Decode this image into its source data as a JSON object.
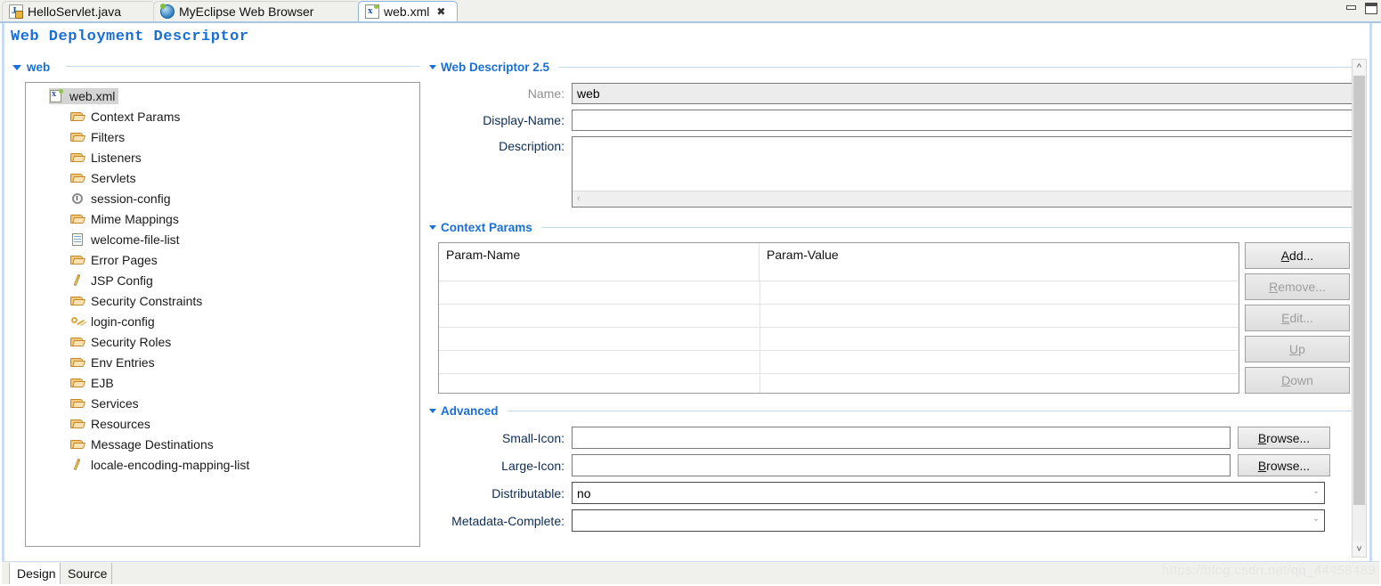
{
  "window": {
    "minimize_label": "minimize",
    "maximize_label": "maximize"
  },
  "editor_tabs": [
    {
      "label": "HelloServlet.java",
      "icon": "java-file-icon",
      "active": false,
      "closable": false
    },
    {
      "label": "MyEclipse Web Browser",
      "icon": "globe-icon",
      "active": false,
      "closable": false
    },
    {
      "label": "web.xml",
      "icon": "xml-file-icon",
      "active": true,
      "closable": true,
      "close_glyph": "✖"
    }
  ],
  "page_title": "Web Deployment Descriptor",
  "tree_section": {
    "header": "web",
    "nodes": [
      {
        "label": "web.xml",
        "icon": "xml-file-icon",
        "selected": true,
        "depth": 0
      },
      {
        "label": "Context Params",
        "icon": "folder-icon",
        "selected": false,
        "depth": 1
      },
      {
        "label": "Filters",
        "icon": "folder-icon",
        "selected": false,
        "depth": 1
      },
      {
        "label": "Listeners",
        "icon": "folder-icon",
        "selected": false,
        "depth": 1
      },
      {
        "label": "Servlets",
        "icon": "folder-icon",
        "selected": false,
        "depth": 1
      },
      {
        "label": "session-config",
        "icon": "clock-icon",
        "selected": false,
        "depth": 1
      },
      {
        "label": "Mime Mappings",
        "icon": "folder-icon",
        "selected": false,
        "depth": 1
      },
      {
        "label": "welcome-file-list",
        "icon": "document-icon",
        "selected": false,
        "depth": 1
      },
      {
        "label": "Error Pages",
        "icon": "folder-icon",
        "selected": false,
        "depth": 1
      },
      {
        "label": "JSP Config",
        "icon": "pencil-icon",
        "selected": false,
        "depth": 1
      },
      {
        "label": "Security Constraints",
        "icon": "folder-icon",
        "selected": false,
        "depth": 1
      },
      {
        "label": "login-config",
        "icon": "key-icon",
        "selected": false,
        "depth": 1
      },
      {
        "label": "Security Roles",
        "icon": "folder-icon",
        "selected": false,
        "depth": 1
      },
      {
        "label": "Env Entries",
        "icon": "folder-icon",
        "selected": false,
        "depth": 1
      },
      {
        "label": "EJB",
        "icon": "folder-icon",
        "selected": false,
        "depth": 1
      },
      {
        "label": "Services",
        "icon": "folder-icon",
        "selected": false,
        "depth": 1
      },
      {
        "label": "Resources",
        "icon": "folder-icon",
        "selected": false,
        "depth": 1
      },
      {
        "label": "Message Destinations",
        "icon": "folder-icon",
        "selected": false,
        "depth": 1
      },
      {
        "label": "locale-encoding-mapping-list",
        "icon": "pencil-icon",
        "selected": false,
        "depth": 1
      }
    ]
  },
  "descriptor_section": {
    "header": "Web Descriptor 2.5",
    "name_label": "Name:",
    "name_value": "web",
    "display_name_label": "Display-Name:",
    "display_name_value": "",
    "description_label": "Description:",
    "description_value": ""
  },
  "context_params_section": {
    "header": "Context Params",
    "columns": [
      "Param-Name",
      "Param-Value"
    ],
    "rows": [],
    "empty_row_count": 5,
    "buttons": [
      {
        "label": "Add...",
        "mnemonic": "A",
        "enabled": true
      },
      {
        "label": "Remove...",
        "mnemonic": "R",
        "enabled": false
      },
      {
        "label": "Edit...",
        "mnemonic": "E",
        "enabled": false
      },
      {
        "label": "Up",
        "mnemonic": "U",
        "enabled": false
      },
      {
        "label": "Down",
        "mnemonic": "D",
        "enabled": false
      }
    ]
  },
  "advanced_section": {
    "header": "Advanced",
    "small_icon_label": "Small-Icon:",
    "small_icon_value": "",
    "small_icon_browse": "Browse...",
    "large_icon_label": "Large-Icon:",
    "large_icon_value": "",
    "large_icon_browse": "Browse...",
    "distributable_label": "Distributable:",
    "distributable_value": "no",
    "metadata_complete_label": "Metadata-Complete:",
    "metadata_complete_value": "",
    "browse_mnemonic": "B",
    "chevron": "ˇ"
  },
  "bottom_tabs": [
    {
      "label": "Design",
      "active": true
    },
    {
      "label": "Source",
      "active": false
    }
  ],
  "watermark": "https://blog.csdn.net/qq_44458489",
  "colors": {
    "accent_blue": "#1a6fd4",
    "tab_border": "#8fb4d9",
    "rule": "#c3d9ee",
    "field_border": "#7a7a7a"
  }
}
